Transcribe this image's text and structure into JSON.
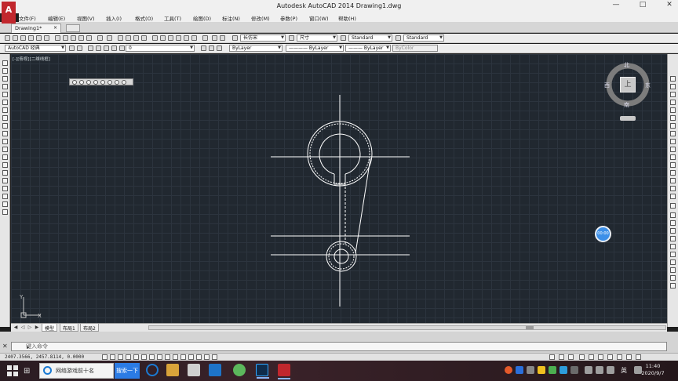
{
  "window": {
    "title": "Autodesk AutoCAD 2014    Drawing1.dwg",
    "app_icon_letter": "A",
    "controls": [
      "—",
      "□",
      "✕"
    ]
  },
  "menu": [
    "文件(F)",
    "编辑(E)",
    "视图(V)",
    "插入(I)",
    "格式(O)",
    "工具(T)",
    "绘图(D)",
    "标注(N)",
    "修改(M)",
    "参数(P)",
    "窗口(W)",
    "帮助(H)"
  ],
  "tabs": {
    "doc": "Drawing1*",
    "close": "×"
  },
  "toolbar1": {
    "linetype_scale": "长仿宋",
    "dim_style_label": "尺寸",
    "text_style": "Standard",
    "table_style": "Standard"
  },
  "toolbar2": {
    "workspace": "AutoCAD 经典",
    "layer": "0",
    "color": "ByLayer",
    "linetype": "———— ByLayer",
    "lineweight": "——— ByLayer",
    "plotstyle": "ByColor"
  },
  "viewport": {
    "label": "[-][俯视][二维线框]",
    "viewcube": {
      "north": "北",
      "south": "南",
      "east": "东",
      "west": "西",
      "top": "上"
    },
    "blue_dot_text": "00:00",
    "ucs_x": "X",
    "ucs_y": "Y"
  },
  "layout_tabs": [
    "模型",
    "布局1",
    "布局2"
  ],
  "command": {
    "placeholder": "键入命令"
  },
  "status": {
    "coords": "2407.3566, 2457.8114, 0.0000"
  },
  "taskbar": {
    "search_text": "网络游戏前十名",
    "search_button": "搜索一下",
    "lang": "英",
    "time": "11:40",
    "date": "2020/9/7"
  },
  "colors": {
    "viewport_bg": "#212830",
    "grid": "#2c343e",
    "geometry": "#ffffff",
    "accent": "#3c8fe8"
  }
}
